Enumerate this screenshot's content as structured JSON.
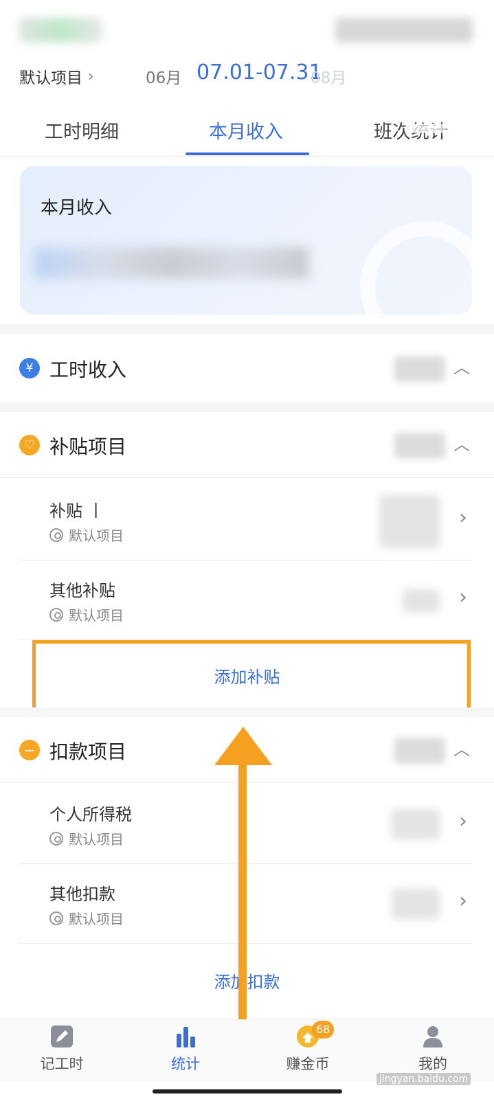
{
  "header": {
    "project_label": "默认项目",
    "prev_month": "06月",
    "current_period": "07.01-07.31",
    "next_month": "08月"
  },
  "tabs": [
    {
      "label": "工时明细"
    },
    {
      "label": "本月收入"
    },
    {
      "label": "班次统计"
    }
  ],
  "summary": {
    "title": "本月收入"
  },
  "sections": {
    "work_income": {
      "title": "工时收入",
      "icon": "yen-icon"
    },
    "subsidy": {
      "title": "补贴项目",
      "items": [
        {
          "name": "补贴 丨",
          "project": "默认项目"
        },
        {
          "name": "其他补贴",
          "project": "默认项目"
        }
      ],
      "add_label": "添加补贴"
    },
    "deduction": {
      "title": "扣款项目",
      "items": [
        {
          "name": "个人所得税",
          "project": "默认项目"
        },
        {
          "name": "其他扣款",
          "project": "默认项目"
        }
      ],
      "add_label": "添加扣款"
    }
  },
  "nav": [
    {
      "label": "记工时"
    },
    {
      "label": "统计"
    },
    {
      "label": "赚金币",
      "badge": "68"
    },
    {
      "label": "我的"
    }
  ],
  "watermark": "jingyan.baidu.com",
  "colors": {
    "accent": "#3a6fd8",
    "highlight": "#f5a020"
  }
}
